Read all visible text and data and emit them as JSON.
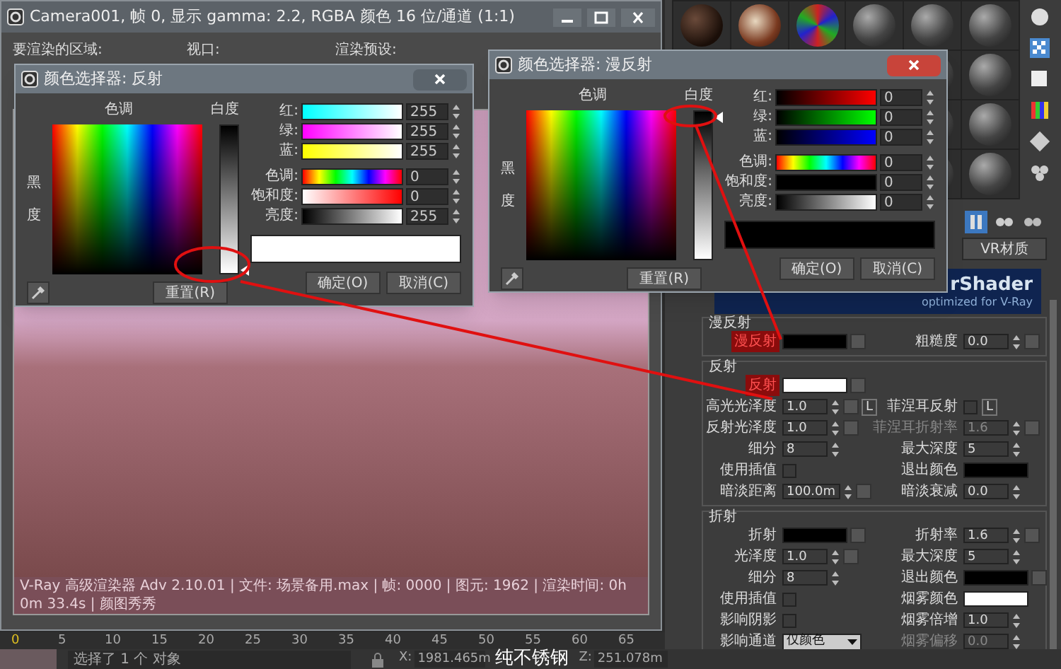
{
  "render_window": {
    "title": "Camera001, 帧 0, 显示 gamma: 2.2, RGBA 颜色 16 位/通道 (1:1)",
    "labels": [
      "要渲染的区域:",
      "视口:",
      "渲染预设:"
    ],
    "stamp": "V-Ray 高级渲染器 Adv 2.10.01 | 文件: 场景备用.max | 帧: 0000 | 图元: 1962 | 渲染时间: 0h 0m 33.4s | 颜图秀秀"
  },
  "color_pickers": [
    {
      "title": "颜色选择器: 反射",
      "active": false,
      "hue_label": "色调",
      "whiteness_label": "白度",
      "blackness_label": [
        "黑",
        "度"
      ],
      "rows": [
        {
          "label": "红:",
          "value": "255"
        },
        {
          "label": "绿:",
          "value": "255"
        },
        {
          "label": "蓝:",
          "value": "255"
        },
        {
          "label": "色调:",
          "value": "0"
        },
        {
          "label": "饱和度:",
          "value": "0"
        },
        {
          "label": "亮度:",
          "value": "255"
        }
      ],
      "reset": "重置(R)",
      "ok": "确定(O)",
      "cancel": "取消(C)"
    },
    {
      "title": "颜色选择器: 漫反射",
      "active": true,
      "hue_label": "色调",
      "whiteness_label": "白度",
      "blackness_label": [
        "黑",
        "度"
      ],
      "rows": [
        {
          "label": "红:",
          "value": "0"
        },
        {
          "label": "绿:",
          "value": "0"
        },
        {
          "label": "蓝:",
          "value": "0"
        },
        {
          "label": "色调:",
          "value": "0"
        },
        {
          "label": "饱和度:",
          "value": "0"
        },
        {
          "label": "亮度:",
          "value": "0"
        }
      ],
      "reset": "重置(R)",
      "ok": "确定(O)",
      "cancel": "取消(C)"
    }
  ],
  "material_editor": {
    "type_button": "VR材质",
    "banner": [
      "rShader",
      "optimized for V-Ray"
    ],
    "groups": [
      {
        "title": "漫反射",
        "rows": [
          {
            "left": {
              "kind": "swatch",
              "label": "漫反射",
              "color": "#000000",
              "highlighted": true,
              "map": true
            },
            "right": {
              "kind": "spinner",
              "label": "粗糙度",
              "value": "0.0",
              "disabled": false,
              "map": true
            }
          }
        ]
      },
      {
        "title": "反射",
        "rows": [
          {
            "left": {
              "kind": "swatch",
              "label": "反射",
              "color": "#ffffff",
              "highlighted": true,
              "map": true
            }
          },
          {
            "left": {
              "kind": "spinner",
              "label": "高光光泽度",
              "value": "1.0",
              "disabled": false,
              "map": true,
              "lock": "L"
            },
            "right": {
              "kind": "checkbox",
              "label": "菲涅耳反射",
              "checked": false,
              "lock": "L"
            }
          },
          {
            "left": {
              "kind": "spinner",
              "label": "反射光泽度",
              "value": "1.0",
              "disabled": false,
              "map": true
            },
            "right": {
              "kind": "spinner",
              "label": "菲涅耳折射率",
              "value": "1.6",
              "disabled": true,
              "map": true
            }
          },
          {
            "left": {
              "kind": "spinner",
              "label": "细分",
              "value": "8",
              "disabled": false
            },
            "right": {
              "kind": "spinner",
              "label": "最大深度",
              "value": "5",
              "disabled": false
            }
          },
          {
            "left": {
              "kind": "checkbox",
              "label": "使用插值",
              "checked": false
            },
            "right": {
              "kind": "swatch",
              "label": "退出颜色",
              "color": "#000000",
              "highlighted": false,
              "map": false
            }
          },
          {
            "left": {
              "kind": "spinner",
              "label": "暗淡距离",
              "value": "100.0m",
              "disabled": false,
              "map": true
            },
            "right": {
              "kind": "spinner",
              "label": "暗淡衰减",
              "value": "0.0",
              "disabled": false
            }
          }
        ]
      },
      {
        "title": "折射",
        "rows": [
          {
            "left": {
              "kind": "swatch",
              "label": "折射",
              "color": "#000000",
              "highlighted": false,
              "map": true
            },
            "right": {
              "kind": "spinner",
              "label": "折射率",
              "value": "1.6",
              "disabled": false,
              "map": true
            }
          },
          {
            "left": {
              "kind": "spinner",
              "label": "光泽度",
              "value": "1.0",
              "disabled": false,
              "map": true
            },
            "right": {
              "kind": "spinner",
              "label": "最大深度",
              "value": "5",
              "disabled": false
            }
          },
          {
            "left": {
              "kind": "spinner",
              "label": "细分",
              "value": "8",
              "disabled": false
            },
            "right": {
              "kind": "swatch",
              "label": "退出颜色",
              "color": "#000000",
              "highlighted": false,
              "map": true
            }
          },
          {
            "left": {
              "kind": "checkbox",
              "label": "使用插值",
              "checked": false
            },
            "right": {
              "kind": "swatch",
              "label": "烟雾颜色",
              "color": "#ffffff",
              "highlighted": false,
              "map": false
            }
          },
          {
            "left": {
              "kind": "checkbox",
              "label": "影响阴影",
              "checked": false
            },
            "right": {
              "kind": "spinner",
              "label": "烟雾倍增",
              "value": "1.0",
              "disabled": false
            }
          },
          {
            "left": {
              "kind": "dropdown",
              "label": "影响通道",
              "value": "仅颜色"
            },
            "right": {
              "kind": "spinner",
              "label": "烟雾偏移",
              "value": "0.0",
              "disabled": true
            }
          }
        ]
      }
    ]
  },
  "timeline": {
    "ticks": [
      {
        "label": "0",
        "selected": true
      },
      {
        "label": "5",
        "selected": false
      },
      {
        "label": "10",
        "selected": false
      },
      {
        "label": "15",
        "selected": false
      },
      {
        "label": "20",
        "selected": false
      },
      {
        "label": "25",
        "selected": false
      },
      {
        "label": "30",
        "selected": false
      },
      {
        "label": "35",
        "selected": false
      },
      {
        "label": "40",
        "selected": false
      },
      {
        "label": "45",
        "selected": false
      },
      {
        "label": "50",
        "selected": false
      },
      {
        "label": "55",
        "selected": false
      },
      {
        "label": "60",
        "selected": false
      },
      {
        "label": "65",
        "selected": false
      }
    ]
  },
  "status_bar": {
    "prompt": "选择了 1 个 对象",
    "x_label": "X:",
    "x": "1981.465m",
    "z_label": "Z:",
    "z": "251.078m"
  },
  "caption": "纯不锈钢"
}
